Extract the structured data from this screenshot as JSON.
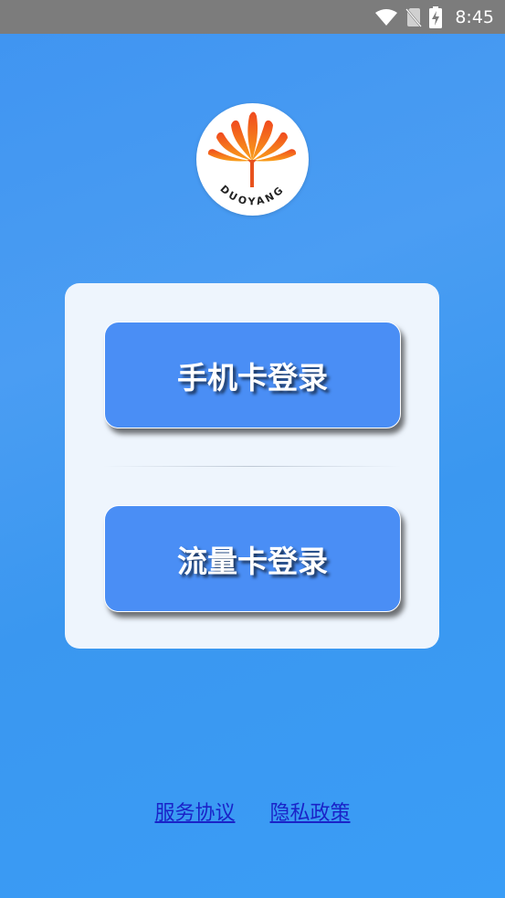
{
  "status_bar": {
    "time": "8:45",
    "icons": [
      "wifi-icon",
      "no-sim-icon",
      "battery-charging-icon"
    ]
  },
  "logo": {
    "text": "DUOYANG",
    "colors": {
      "petal_outer": "#f04a1e",
      "petal_inner": "#f9a01b",
      "stem": "#e8531e"
    }
  },
  "login": {
    "phone_card_label": "手机卡登录",
    "data_card_label": "流量卡登录"
  },
  "footer": {
    "terms_label": "服务协议",
    "privacy_label": "隐私政策"
  },
  "colors": {
    "background": "#4199f3",
    "card": "#eef5fd",
    "button": "#4a8ef5",
    "link": "#1a23c8",
    "status_bar": "#7c7c7c"
  }
}
